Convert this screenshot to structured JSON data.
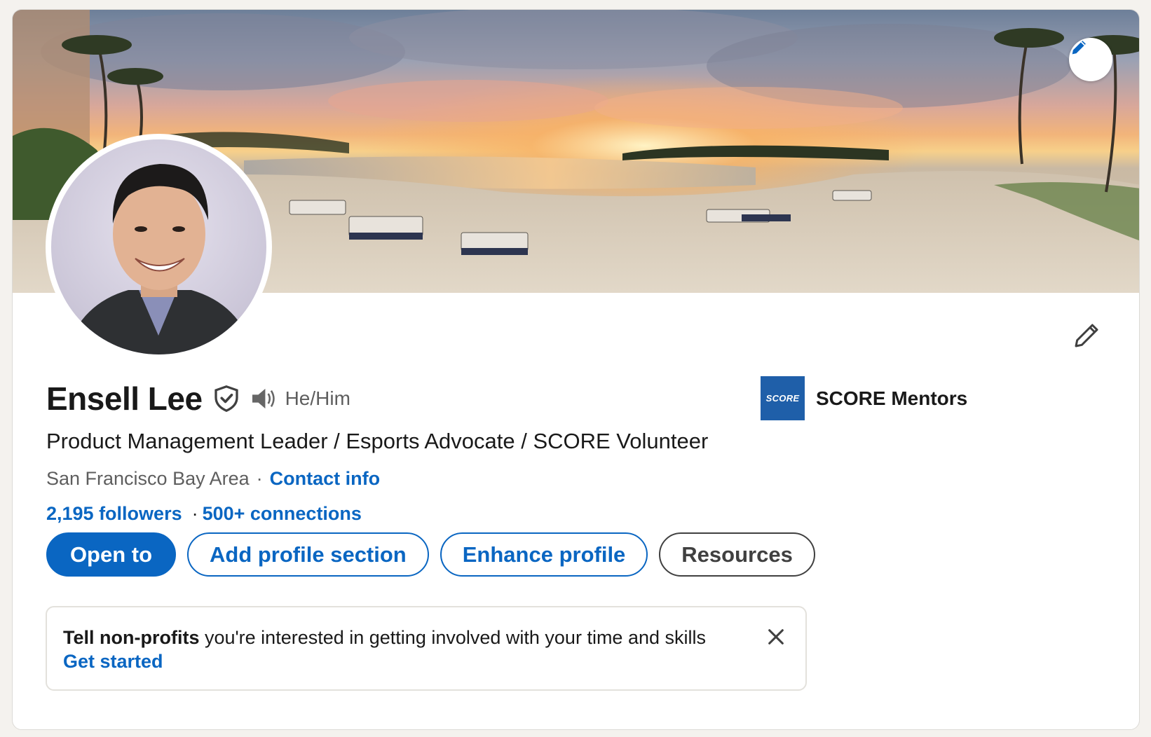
{
  "profile": {
    "name": "Ensell Lee",
    "pronouns": "He/Him",
    "headline": "Product Management Leader / Esports Advocate / SCORE Volunteer",
    "location": "San Francisco Bay Area",
    "contact_info_label": "Contact info",
    "followers": "2,195 followers",
    "connections": "500+ connections",
    "separator": "·"
  },
  "company": {
    "logo_text": "SCORE",
    "name": "SCORE Mentors"
  },
  "actions": {
    "open_to": "Open to",
    "add_profile_section": "Add profile section",
    "enhance_profile": "Enhance profile",
    "resources": "Resources"
  },
  "notice": {
    "bold_text": "Tell non-profits",
    "text": " you're interested in getting involved with your time and skills",
    "cta": "Get started"
  },
  "icons": {
    "banner_edit": "pencil-icon",
    "profile_edit": "pencil-icon",
    "verified": "shield-check-icon",
    "pronunciation": "speaker-icon",
    "close": "close-icon"
  },
  "colors": {
    "accent": "#0a66c2",
    "company_logo_bg": "#1f5fa9"
  }
}
